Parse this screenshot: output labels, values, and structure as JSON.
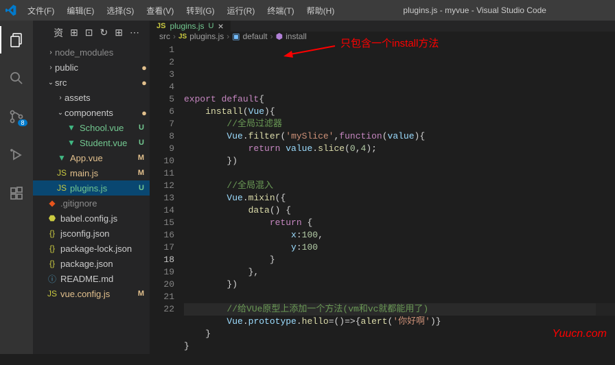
{
  "window": {
    "title": "plugins.js - myvue - Visual Studio Code"
  },
  "menu": [
    "文件(F)",
    "编辑(E)",
    "选择(S)",
    "查看(V)",
    "转到(G)",
    "运行(R)",
    "终端(T)",
    "帮助(H)"
  ],
  "activity": {
    "badge": "8"
  },
  "sidebar_icons": [
    "资",
    "⊞",
    "⊡",
    "↻",
    "⊞",
    "⋯"
  ],
  "explorer": {
    "items": [
      {
        "type": "folder",
        "name": "node_modules",
        "open": false,
        "indent": 1,
        "dimmed": true
      },
      {
        "type": "folder",
        "name": "public",
        "open": false,
        "indent": 1,
        "dot": true
      },
      {
        "type": "folder",
        "name": "src",
        "open": true,
        "indent": 1,
        "dot": true
      },
      {
        "type": "folder",
        "name": "assets",
        "open": false,
        "indent": 2
      },
      {
        "type": "folder",
        "name": "components",
        "open": true,
        "indent": 2,
        "dot": true
      },
      {
        "type": "file",
        "name": "School.vue",
        "icon": "vue",
        "indent": 3,
        "status": "U"
      },
      {
        "type": "file",
        "name": "Student.vue",
        "icon": "vue",
        "indent": 3,
        "status": "U"
      },
      {
        "type": "file",
        "name": "App.vue",
        "icon": "vue",
        "indent": 2,
        "status": "M"
      },
      {
        "type": "file",
        "name": "main.js",
        "icon": "js",
        "indent": 2,
        "status": "M"
      },
      {
        "type": "file",
        "name": "plugins.js",
        "icon": "js",
        "indent": 2,
        "status": "U",
        "selected": true
      },
      {
        "type": "file",
        "name": ".gitignore",
        "icon": "git",
        "indent": 1,
        "dimmed": true
      },
      {
        "type": "file",
        "name": "babel.config.js",
        "icon": "babel",
        "indent": 1
      },
      {
        "type": "file",
        "name": "jsconfig.json",
        "icon": "json",
        "indent": 1
      },
      {
        "type": "file",
        "name": "package-lock.json",
        "icon": "json",
        "indent": 1
      },
      {
        "type": "file",
        "name": "package.json",
        "icon": "json",
        "indent": 1
      },
      {
        "type": "file",
        "name": "README.md",
        "icon": "md",
        "indent": 1
      },
      {
        "type": "file",
        "name": "vue.config.js",
        "icon": "js",
        "indent": 1,
        "status": "M"
      }
    ]
  },
  "tab": {
    "icon": "JS",
    "name": "plugins.js",
    "status": "U"
  },
  "breadcrumb": [
    "src",
    "plugins.js",
    "default",
    "install"
  ],
  "code": {
    "lines": [
      {
        "n": 1,
        "html": "<span class='k-key'>export</span> <span class='k-key'>default</span><span class='k-punc'>{</span>"
      },
      {
        "n": 2,
        "html": "    <span class='k-fn'>install</span><span class='k-punc'>(</span><span class='k-var'>Vue</span><span class='k-punc'>){</span>"
      },
      {
        "n": 3,
        "html": "        <span class='k-cmt'>//全局过滤器</span>"
      },
      {
        "n": 4,
        "html": "        <span class='k-var'>Vue</span><span class='k-punc'>.</span><span class='k-fn'>filter</span><span class='k-punc'>(</span><span class='k-str'>'mySlice'</span><span class='k-punc'>,</span><span class='k-key'>function</span><span class='k-punc'>(</span><span class='k-var'>value</span><span class='k-punc'>){</span>"
      },
      {
        "n": 5,
        "html": "            <span class='k-key'>return</span> <span class='k-var'>value</span><span class='k-punc'>.</span><span class='k-fn'>slice</span><span class='k-punc'>(</span><span class='k-num'>0</span><span class='k-punc'>,</span><span class='k-num'>4</span><span class='k-punc'>);</span>"
      },
      {
        "n": 6,
        "html": "        <span class='k-punc'>})</span>"
      },
      {
        "n": 7,
        "html": ""
      },
      {
        "n": 8,
        "html": "        <span class='k-cmt'>//全局混入</span>"
      },
      {
        "n": 9,
        "html": "        <span class='k-var'>Vue</span><span class='k-punc'>.</span><span class='k-fn'>mixin</span><span class='k-punc'>({</span>"
      },
      {
        "n": 10,
        "html": "            <span class='k-fn'>data</span><span class='k-punc'>() {</span>"
      },
      {
        "n": 11,
        "html": "                <span class='k-key'>return</span> <span class='k-punc'>{</span>"
      },
      {
        "n": 12,
        "html": "                    <span class='k-var'>x</span><span class='k-punc'>:</span><span class='k-num'>100</span><span class='k-punc'>,</span>"
      },
      {
        "n": 13,
        "html": "                    <span class='k-var'>y</span><span class='k-punc'>:</span><span class='k-num'>100</span>"
      },
      {
        "n": 14,
        "html": "                <span class='k-punc'>}</span>"
      },
      {
        "n": 15,
        "html": "            <span class='k-punc'>},</span>"
      },
      {
        "n": 16,
        "html": "        <span class='k-punc'>})</span>"
      },
      {
        "n": 17,
        "html": ""
      },
      {
        "n": 18,
        "html": "        <span class='k-cmt'>//给VUe原型上添加一个方法(vm和vc就都能用了)</span>",
        "active": true
      },
      {
        "n": 19,
        "html": "        <span class='k-var'>Vue</span><span class='k-punc'>.</span><span class='k-var'>prototype</span><span class='k-punc'>.</span><span class='k-fn'>hello</span><span class='k-punc'>=()=&gt;{</span><span class='k-fn'>alert</span><span class='k-punc'>(</span><span class='k-str'>'你好啊'</span><span class='k-punc'>)}</span>"
      },
      {
        "n": 20,
        "html": "    <span class='k-punc'>}</span>"
      },
      {
        "n": 21,
        "html": "<span class='k-punc'>}</span>"
      },
      {
        "n": 22,
        "html": ""
      }
    ]
  },
  "annotation": {
    "text": "只包含一个install方法"
  },
  "watermark": "Yuucn.com"
}
